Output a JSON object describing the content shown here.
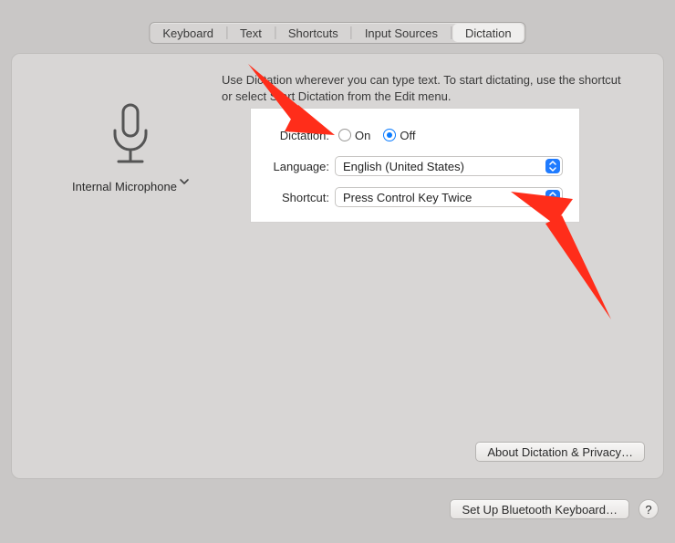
{
  "tabs": {
    "items": [
      "Keyboard",
      "Text",
      "Shortcuts",
      "Input Sources",
      "Dictation"
    ],
    "active_index": 4
  },
  "description": "Use Dictation wherever you can type text. To start dictating, use the shortcut or select Start Dictation from the Edit menu.",
  "mic": {
    "label": "Internal Microphone"
  },
  "dictation": {
    "label": "Dictation:",
    "on_label": "On",
    "off_label": "Off",
    "value": "off"
  },
  "language": {
    "label": "Language:",
    "value": "English (United States)"
  },
  "shortcut": {
    "label": "Shortcut:",
    "value": "Press Control Key Twice"
  },
  "about_button": "About Dictation & Privacy…",
  "setup_button": "Set Up Bluetooth Keyboard…",
  "help_button": "?"
}
